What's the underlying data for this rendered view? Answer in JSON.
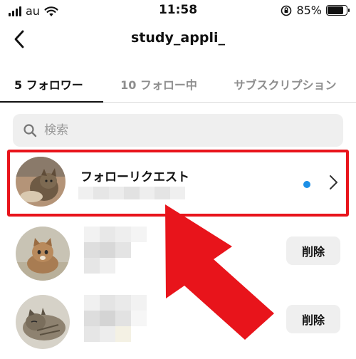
{
  "status_bar": {
    "carrier": "au",
    "time": "11:58",
    "battery_percent": "85%",
    "battery_level": 0.85,
    "icons": [
      "signal-bars-icon",
      "wifi-icon",
      "orientation-lock-icon",
      "battery-icon"
    ]
  },
  "header": {
    "title": "study_appli_",
    "back_icon": "chevron-left-icon"
  },
  "tabs": [
    {
      "label": "5 フォロワー",
      "active": true
    },
    {
      "label": "10 フォロー中",
      "active": false
    },
    {
      "label": "サブスクリプション",
      "active": false
    }
  ],
  "search": {
    "placeholder": "検索",
    "value": "",
    "icon": "search-icon"
  },
  "follow_request": {
    "label": "フォローリクエスト",
    "unread_dot_color": "#1c8fe6",
    "icon": "chevron-right-icon"
  },
  "followers": [
    {
      "remove_label": "削除"
    },
    {
      "remove_label": "削除"
    }
  ],
  "annotation": {
    "highlight_color": "#e8141b",
    "arrow_color": "#e8141b"
  }
}
